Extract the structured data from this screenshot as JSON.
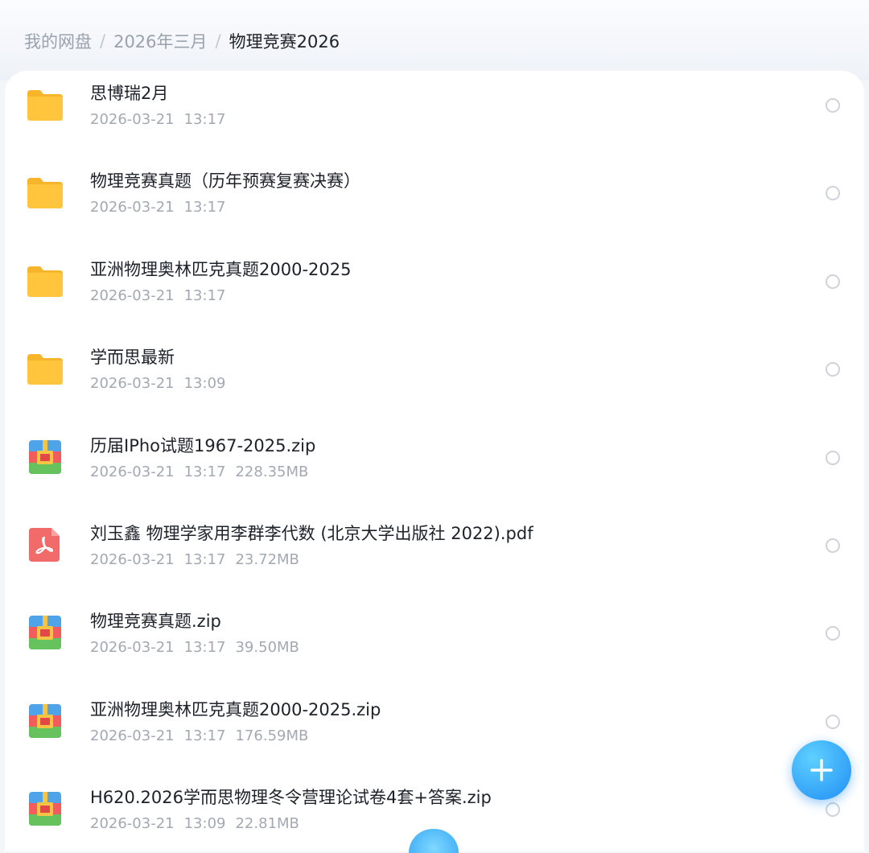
{
  "breadcrumb": {
    "items": [
      "我的网盘",
      "2026年三月"
    ],
    "separator": "/",
    "current": "物理竞赛2026"
  },
  "files": [
    {
      "name": "思博瑞2月",
      "date": "2026-03-21",
      "time": "13:17",
      "size": "",
      "icon": "folder-icon"
    },
    {
      "name": "物理竞赛真题（历年预赛复赛决赛）",
      "date": "2026-03-21",
      "time": "13:17",
      "size": "",
      "icon": "folder-icon"
    },
    {
      "name": "亚洲物理奥林匹克真题2000-2025",
      "date": "2026-03-21",
      "time": "13:17",
      "size": "",
      "icon": "folder-icon"
    },
    {
      "name": "学而思最新",
      "date": "2026-03-21",
      "time": "13:09",
      "size": "",
      "icon": "folder-icon"
    },
    {
      "name": "历届IPho试题1967-2025.zip",
      "date": "2026-03-21",
      "time": "13:17",
      "size": "228.35MB",
      "icon": "zip-icon"
    },
    {
      "name": "刘玉鑫  物理学家用李群李代数 (北京大学出版社 2022).pdf",
      "date": "2026-03-21",
      "time": "13:17",
      "size": "23.72MB",
      "icon": "pdf-icon"
    },
    {
      "name": "物理竞赛真题.zip",
      "date": "2026-03-21",
      "time": "13:17",
      "size": "39.50MB",
      "icon": "zip-icon"
    },
    {
      "name": "亚洲物理奥林匹克真题2000-2025.zip",
      "date": "2026-03-21",
      "time": "13:17",
      "size": "176.59MB",
      "icon": "zip-icon"
    },
    {
      "name": "H620.2026学而思物理冬令营理论试卷4套+答案.zip",
      "date": "2026-03-21",
      "time": "13:09",
      "size": "22.81MB",
      "icon": "zip-icon"
    }
  ],
  "colors": {
    "folder": "#FFC53D",
    "pdf": "#F26B6B",
    "accent": "#1F8EF5"
  },
  "fab": {
    "icon": "plus-icon"
  }
}
